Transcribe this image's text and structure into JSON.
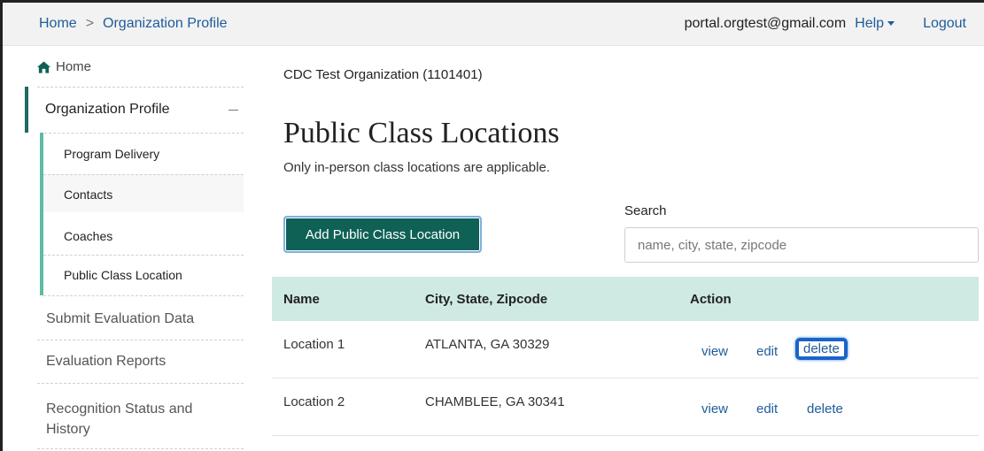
{
  "breadcrumb": {
    "home": "Home",
    "separator": ">",
    "current": "Organization Profile"
  },
  "header": {
    "email": "portal.orgtest@gmail.com",
    "help": "Help",
    "logout": "Logout"
  },
  "sidebar": {
    "home": "Home",
    "org_profile": "Organization Profile",
    "sub_items": [
      "Program Delivery",
      "Contacts",
      "Coaches",
      "Public Class Location"
    ],
    "items": [
      "Submit Evaluation Data",
      "Evaluation Reports",
      "Recognition Status and History"
    ]
  },
  "main": {
    "org_name": "CDC Test Organization (1101401)",
    "title": "Public Class Locations",
    "subtitle": "Only in-person class locations are applicable.",
    "add_button": "Add Public Class Location",
    "search_label": "Search",
    "search_placeholder": "name, city, state, zipcode"
  },
  "table": {
    "headers": [
      "Name",
      "City, State, Zipcode",
      "Action"
    ],
    "rows": [
      {
        "name": "Location 1",
        "city": "ATLANTA, GA 30329",
        "view": "view",
        "edit": "edit",
        "delete": "delete"
      },
      {
        "name": "Location 2",
        "city": "CHAMBLEE, GA 30341",
        "view": "view",
        "edit": "edit",
        "delete": "delete"
      }
    ]
  },
  "colors": {
    "primary_button": "#0f6155",
    "accent_bar": "#5fbaa6",
    "table_header": "#cfe9e3",
    "link": "#1f5c99",
    "focus_ring": "#1a64c8"
  },
  "icons": {
    "home": "home-icon",
    "collapse": "minus-icon",
    "help_dropdown": "caret-down-icon"
  }
}
